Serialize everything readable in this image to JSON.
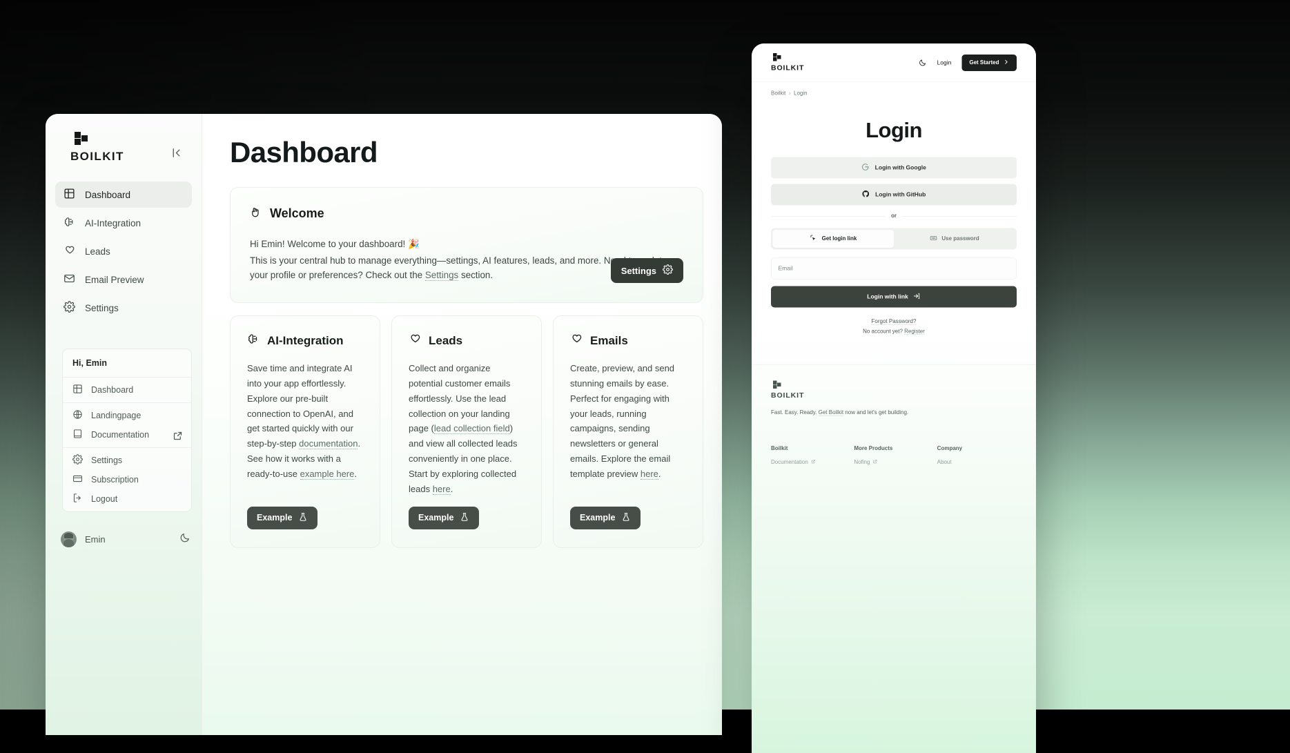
{
  "brand": {
    "name": "BOILKIT"
  },
  "dashboard": {
    "sidebar": {
      "collapse_icon": "collapse-panel-icon",
      "nav": [
        {
          "label": "Dashboard",
          "icon": "grid-icon",
          "active": true
        },
        {
          "label": "AI-Integration",
          "icon": "brain-icon",
          "active": false
        },
        {
          "label": "Leads",
          "icon": "heart-icon",
          "active": false
        },
        {
          "label": "Email Preview",
          "icon": "mail-icon",
          "active": false
        },
        {
          "label": "Settings",
          "icon": "gear-icon",
          "active": false
        }
      ],
      "user_menu": {
        "greeting": "Hi, Emin",
        "groups": [
          [
            {
              "label": "Dashboard",
              "icon": "grid-icon"
            }
          ],
          [
            {
              "label": "Landingpage",
              "icon": "globe-icon"
            },
            {
              "label": "Documentation",
              "icon": "book-icon",
              "external": true
            }
          ],
          [
            {
              "label": "Settings",
              "icon": "gear-icon"
            },
            {
              "label": "Subscription",
              "icon": "card-icon"
            },
            {
              "label": "Logout",
              "icon": "logout-icon"
            }
          ]
        ]
      },
      "footer": {
        "username": "Emin",
        "theme_icon": "moon-icon"
      }
    },
    "page_title": "Dashboard",
    "welcome": {
      "title": "Welcome",
      "icon": "rock-hand-icon",
      "line1": "Hi Emin! Welcome to your dashboard! 🎉",
      "line2_a": "This is your central hub to manage everything—settings, AI features, leads, and more. Need to update your profile or preferences? Check out the ",
      "link": "Settings",
      "line2_b": " section.",
      "button": {
        "label": "Settings",
        "icon": "gear-icon"
      }
    },
    "cards": [
      {
        "title": "AI-Integration",
        "icon": "brain-icon",
        "text_a": "Save time and integrate AI into your app effortlessly. Explore our pre-built connection to OpenAI, and get started quickly with our step-by-step ",
        "link1": "documentation",
        "text_b": ". See how it works with a ready-to-use ",
        "link2": "example here",
        "text_c": ".",
        "button": {
          "label": "Example",
          "icon": "flask-icon"
        }
      },
      {
        "title": "Leads",
        "icon": "heart-icon",
        "text_a": "Collect and organize potential customer emails effortlessly. Use the lead collection on your landing page (",
        "link1": "lead collection field",
        "text_b": ") and view all collected leads conveniently in one place. Start by exploring collected leads ",
        "link2": "here",
        "text_c": ".",
        "button": {
          "label": "Example",
          "icon": "flask-icon"
        }
      },
      {
        "title": "Emails",
        "icon": "heart-icon",
        "text_a": "Create, preview, and send stunning emails by ease. Perfect for engaging with your leads, running campaigns, sending newsletters or general emails. Explore the email template preview ",
        "link1": "here",
        "text_b": ".",
        "link2": "",
        "text_c": "",
        "button": {
          "label": "Example",
          "icon": "flask-icon"
        }
      }
    ]
  },
  "login_window": {
    "header": {
      "theme_icon": "moon-icon",
      "login_label": "Login",
      "get_started_label": "Get Started",
      "get_started_icon": "chevron-right-icon"
    },
    "breadcrumb": {
      "root": "Boilkit",
      "separator": "›",
      "current": "Login"
    },
    "heading": "Login",
    "oauth": [
      {
        "label": "Login with Google",
        "icon": "google-icon"
      },
      {
        "label": "Login with GitHub",
        "icon": "github-icon"
      }
    ],
    "divider": "or",
    "tabs": [
      {
        "label": "Get login link",
        "icon": "cursor-click-icon",
        "active": true
      },
      {
        "label": "Use password",
        "icon": "password-dots-icon",
        "active": false
      }
    ],
    "email_placeholder": "Email",
    "email_value": "",
    "submit": {
      "label": "Login with link",
      "icon": "login-arrow-icon"
    },
    "forgot_password": "Forgot Password?",
    "no_account_prefix": "No account yet? ",
    "register_label": "Register",
    "footer": {
      "tagline_a": "Fast. Easy. Ready. ",
      "tagline_link": "Get Boilkit",
      "tagline_b": " now and let's get building.",
      "columns": [
        {
          "heading": "Boilkit",
          "links": [
            {
              "label": "Documentation",
              "external": true
            }
          ]
        },
        {
          "heading": "More Products",
          "links": [
            {
              "label": "Nofing",
              "external": true
            }
          ]
        },
        {
          "heading": "Company",
          "links": [
            {
              "label": "About",
              "external": false
            }
          ]
        }
      ]
    }
  },
  "colors": {
    "accent_dark": "#343a34",
    "button_dark": "#474d47",
    "brand_black": "#141716",
    "bg_green": "#c5ecd0",
    "bg_black": "#050505"
  }
}
